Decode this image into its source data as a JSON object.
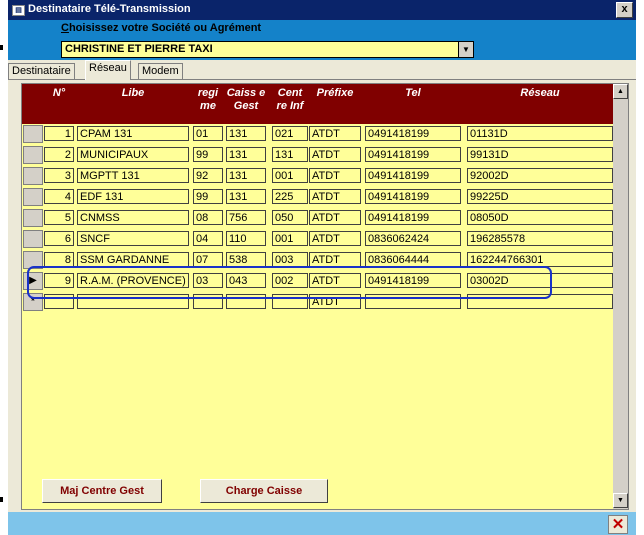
{
  "window": {
    "title": "Destinataire Télé-Transmission",
    "close_label": "x"
  },
  "header": {
    "label_prefix": "C",
    "label_rest": "hoisissez votre Société ou Agrément",
    "combo_value": "CHRISTINE ET PIERRE TAXI"
  },
  "tabs": [
    {
      "label": "Destinataire",
      "active": false
    },
    {
      "label": "Réseau",
      "active": true
    },
    {
      "label": "Modem",
      "active": false
    }
  ],
  "grid": {
    "columns": [
      {
        "label": "N°"
      },
      {
        "label": "Libe"
      },
      {
        "label": "regi me"
      },
      {
        "label": "Caiss e Gest"
      },
      {
        "label": "Cent re Inf"
      },
      {
        "label": "Préfixe"
      },
      {
        "label": "Tel"
      },
      {
        "label": "Réseau"
      }
    ],
    "rows": [
      {
        "n": "1",
        "libe": "CPAM 131",
        "regime": "01",
        "caisse": "131",
        "centre": "021",
        "prefixe": "ATDT",
        "tel": "0491418199",
        "reseau": "01131D"
      },
      {
        "n": "2",
        "libe": "MUNICIPAUX",
        "regime": "99",
        "caisse": "131",
        "centre": "131",
        "prefixe": "ATDT",
        "tel": "0491418199",
        "reseau": "99131D"
      },
      {
        "n": "3",
        "libe": "MGPTT 131",
        "regime": "92",
        "caisse": "131",
        "centre": "001",
        "prefixe": "ATDT",
        "tel": "0491418199",
        "reseau": "92002D"
      },
      {
        "n": "4",
        "libe": "EDF 131",
        "regime": "99",
        "caisse": "131",
        "centre": "225",
        "prefixe": "ATDT",
        "tel": "0491418199",
        "reseau": "99225D"
      },
      {
        "n": "5",
        "libe": "CNMSS",
        "regime": "08",
        "caisse": "756",
        "centre": "050",
        "prefixe": "ATDT",
        "tel": "0491418199",
        "reseau": "08050D"
      },
      {
        "n": "6",
        "libe": "SNCF",
        "regime": "04",
        "caisse": "110",
        "centre": "001",
        "prefixe": "ATDT",
        "tel": "0836062424",
        "reseau": "196285578"
      },
      {
        "n": "8",
        "libe": "SSM GARDANNE",
        "regime": "07",
        "caisse": "538",
        "centre": "003",
        "prefixe": "ATDT",
        "tel": "0836064444",
        "reseau": "162244766301"
      },
      {
        "n": "9",
        "libe": "R.A.M. (PROVENCE)",
        "regime": "03",
        "caisse": "043",
        "centre": "002",
        "prefixe": "ATDT",
        "tel": "0491418199",
        "reseau": "03002D"
      }
    ],
    "new_row": {
      "prefixe": "ATDT"
    },
    "current_marker": "▶",
    "new_marker": "*"
  },
  "buttons": {
    "maj": "Maj Centre Gest",
    "charge": "Charge Caisse"
  },
  "status": {
    "close_label": "✕"
  },
  "colors": {
    "title_bar": "#0a246a",
    "header_bg": "#1482c9",
    "grid_header": "#800000",
    "cell_bg": "#ffff99",
    "highlight": "#1a32c8",
    "status_bg": "#7ec4ea",
    "close_x": "#c00000"
  }
}
